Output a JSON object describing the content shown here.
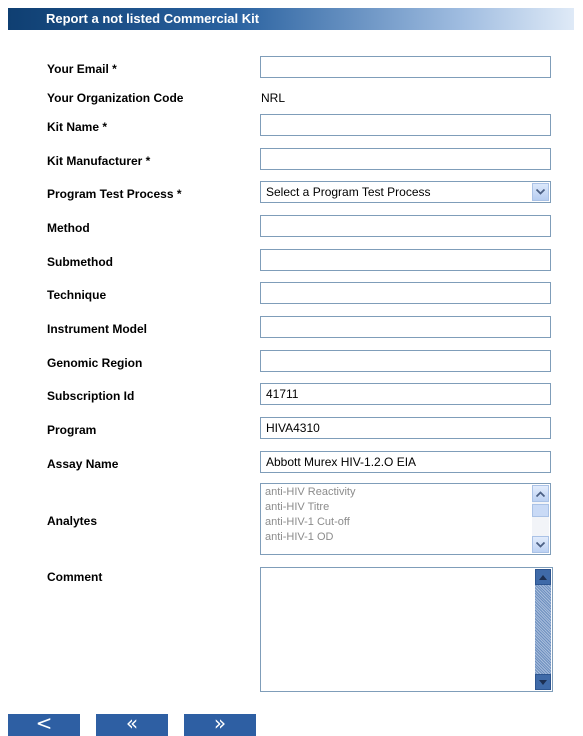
{
  "form": {
    "title": "Report a not listed Commercial Kit",
    "fields": [
      {
        "label": "Your Email *",
        "value": ""
      },
      {
        "label": "Your Organization Code",
        "value": "NRL"
      },
      {
        "label": "Kit Name *",
        "value": ""
      },
      {
        "label": "Kit Manufacturer *",
        "value": ""
      },
      {
        "label": "Program Test Process *",
        "value": "Select a Program Test Process"
      },
      {
        "label": "Method",
        "value": ""
      },
      {
        "label": "Submethod",
        "value": ""
      },
      {
        "label": "Technique",
        "value": ""
      },
      {
        "label": "Instrument Model",
        "value": ""
      },
      {
        "label": "Genomic Region",
        "value": ""
      },
      {
        "label": "Subscription Id",
        "value": "41711"
      },
      {
        "label": "Program",
        "value": "HIVA4310"
      },
      {
        "label": "Assay Name",
        "value": "Abbott Murex HIV-1.2.O EIA"
      },
      {
        "label": "Analytes",
        "options": [
          "anti-HIV Reactivity",
          "anti-HIV Titre",
          "anti-HIV-1 Cut-off",
          "anti-HIV-1 OD"
        ]
      },
      {
        "label": "Comment",
        "value": ""
      }
    ]
  },
  "nav": {
    "back_glyph": "<",
    "first_glyph": "«",
    "next_glyph": "»"
  },
  "icons": {
    "dropdown": "chevron-down-icon",
    "scroll_up": "scroll-up-icon",
    "scroll_down": "scroll-down-icon"
  },
  "colors": {
    "header_start": "#0f3f72",
    "button_blue": "#2e5fa3",
    "input_border": "#7f9db9"
  }
}
